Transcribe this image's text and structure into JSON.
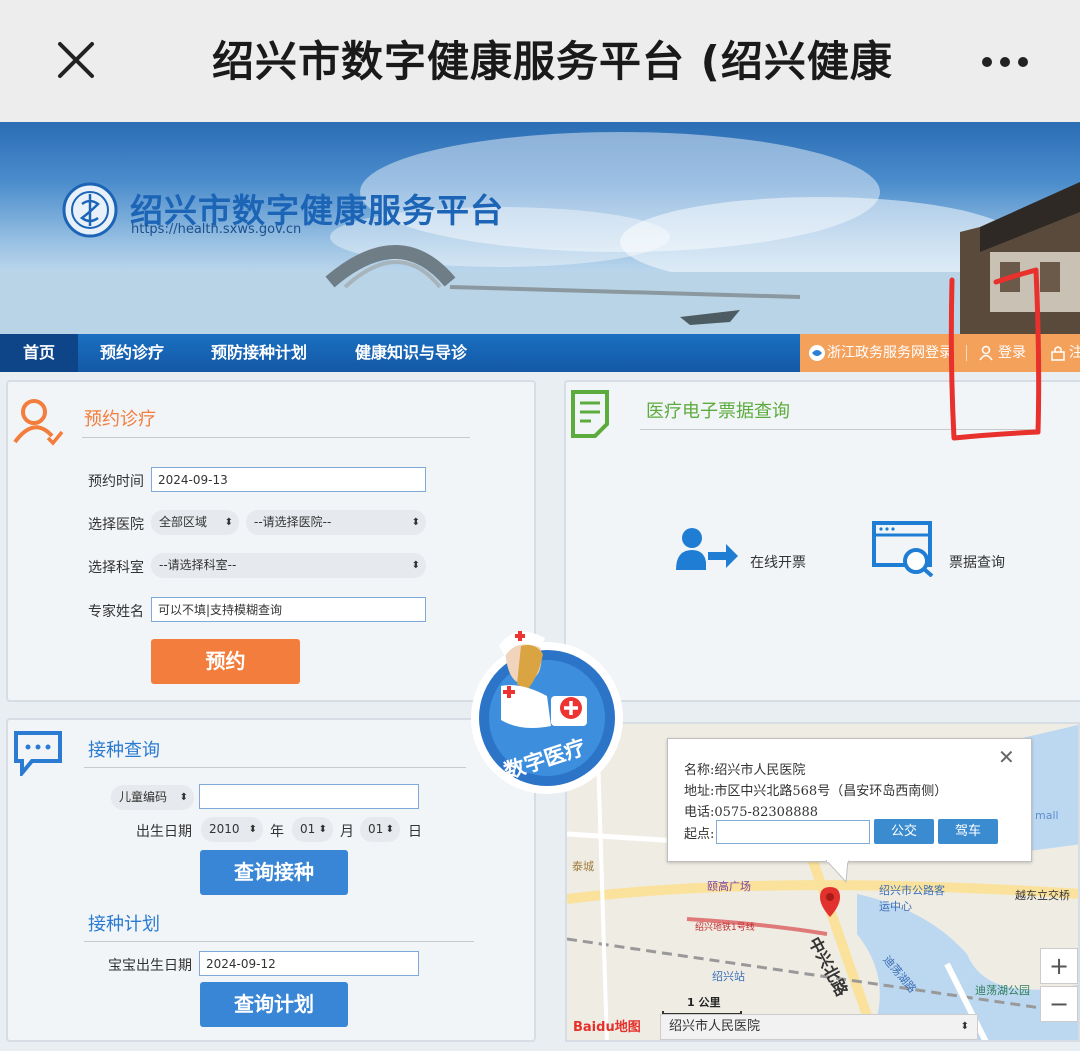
{
  "topbar": {
    "title": "绍兴市数字健康服务平台 (绍兴健康"
  },
  "header": {
    "site_title": "绍兴市数字健康服务平台",
    "site_url": "https://health.sxws.gov.cn"
  },
  "nav": {
    "items": [
      {
        "label": "首页"
      },
      {
        "label": "预约诊疗"
      },
      {
        "label": "预防接种计划"
      },
      {
        "label": "健康知识与导诊"
      }
    ],
    "gov_login": "浙江政务服务网登录",
    "login": "登录",
    "register": "注"
  },
  "appointment": {
    "title": "预约诊疗",
    "time_label": "预约时间",
    "time_value": "2024-09-13",
    "hospital_label": "选择医院",
    "region_value": "全部区域",
    "hospital_value": "--请选择医院--",
    "dept_label": "选择科室",
    "dept_value": "--请选择科室--",
    "expert_label": "专家姓名",
    "expert_placeholder": "可以不填|支持模糊查询",
    "submit": "预约"
  },
  "invoice": {
    "title": "医疗电子票据查询",
    "online_label": "在线开票",
    "query_label": "票据查询"
  },
  "badge": {
    "text": "数字医疗"
  },
  "vaccination": {
    "title": "接种查询",
    "id_type": "儿童编码",
    "id_value": "",
    "birth_label": "出生日期",
    "year": "2010",
    "year_unit": "年",
    "month": "01",
    "month_unit": "月",
    "day": "01",
    "day_unit": "日",
    "query_button": "查询接种",
    "plan_title": "接种计划",
    "baby_birth_label": "宝宝出生日期",
    "baby_birth_value": "2024-09-12",
    "plan_button": "查询计划"
  },
  "map": {
    "popup": {
      "name": "名称:绍兴市人民医院",
      "address": "地址:市区中兴北路568号（昌安环岛西南侧）",
      "phone": "电话:0575-82308888",
      "start_label": "起点:",
      "start_value": "",
      "bus_button": "公交",
      "drive_button": "驾车"
    },
    "places": {
      "p1": "泰城",
      "p2": "颐高广场",
      "p3": "绍兴市公路客运中心",
      "p4": "越东立交桥",
      "p5": "绍兴地铁1号线",
      "p6": "中兴北路",
      "p7": "绍兴站",
      "p8": "迪荡湖公园",
      "p9": "迪荡湖路",
      "p10": "mall"
    },
    "scale": "1 公里",
    "logo": "Baidu地图",
    "select_value": "绍兴市人民医院",
    "zoom_in": "+",
    "zoom_out": "−"
  },
  "colors": {
    "nav_blue": "#1a6fc1",
    "accent_orange": "#f37d3c",
    "button_blue": "#3a86d6",
    "invoice_green": "#5cab3d",
    "annotation_red": "#e8302c"
  }
}
